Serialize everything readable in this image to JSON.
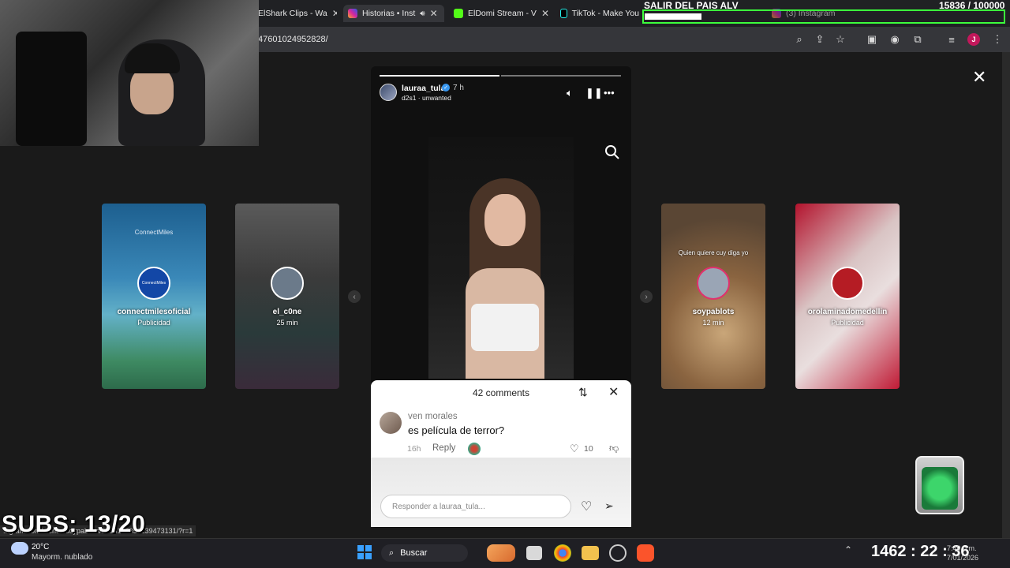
{
  "browser": {
    "tabs": [
      {
        "label": "ElShark Clips - Wa",
        "active": false
      },
      {
        "label": "Historias • Inst",
        "active": true
      },
      {
        "label": "ElDomi Stream - V",
        "active": false
      },
      {
        "label": "TikTok - Make You",
        "active": false
      },
      {
        "label": "(3) Instagram",
        "active": false
      }
    ],
    "url": "47601024952828/"
  },
  "stream": {
    "goal_label": "SALIR DEL PAIS ALV",
    "goal_counter": "15836 / 100000",
    "goal_fraction": 0.158,
    "subs": "SUBS: 13/20",
    "big_time": "1462 : 22 : 36"
  },
  "story": {
    "username": "lauraa_tula",
    "verified_mark": "✓",
    "time": "7 h",
    "audio": "d2s1 · unwanted",
    "icons": [
      "volume-icon",
      "pause-icon",
      "more-icon",
      "search-icon"
    ]
  },
  "side_stories": [
    {
      "name": "connectmilesoficial",
      "sub": "Publicidad",
      "avatar_text": "ConnectMiles",
      "card_text": "ConnectMiles"
    },
    {
      "name": "el_c0ne",
      "sub": "25 min",
      "avatar_text": "",
      "card_text": ""
    },
    {
      "name": "soypablots",
      "sub": "12 min",
      "avatar_text": "",
      "card_text": "Quien quiere cuy diga yo"
    },
    {
      "name": "orolaminadomedellin",
      "sub": "Publicidad",
      "avatar_text": "",
      "card_text": ""
    }
  ],
  "comments": {
    "title": "42 comments",
    "items": [
      {
        "user": "ven morales",
        "text": "es película de terror?",
        "time": "16h",
        "reply": "Reply",
        "likes": "10"
      }
    ],
    "input_placeholder": "Responder a lauraa_tula..."
  },
  "statusbar_url": "...gram.com/stories/soypablots/3805178355239473131/?r=1",
  "taskbar": {
    "weather_temp": "20°C",
    "weather_desc": "Mayorm. nublado",
    "search_label": "Buscar",
    "tray_time": "7:49 p.m.",
    "tray_date": "7/01/2026"
  },
  "colors": {
    "accent_green": "#3cff3c",
    "verified_blue": "#3897f0"
  }
}
